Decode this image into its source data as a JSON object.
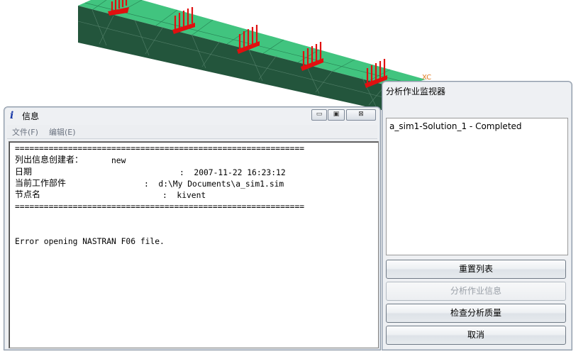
{
  "viewport": {
    "axis_label": "XC"
  },
  "info_window": {
    "title": "信息",
    "controls": {
      "minimize": "▭",
      "maximize": "▣",
      "close": "⊠"
    },
    "menu": [
      "文件(F)",
      "编辑(E)"
    ],
    "separator": "============================================================",
    "lines": [
      {
        "label": "列出信息创建者：",
        "value": "new"
      },
      {
        "label": "日期",
        "value": ":  2007-11-22 16:23:12"
      },
      {
        "label": "当前工作部件",
        "value": ":  d:\\My Documents\\a_sim1.sim"
      },
      {
        "label": "节点名",
        "value": ":  kivent"
      }
    ],
    "error": "Error opening NASTRAN F06 file."
  },
  "monitor_window": {
    "title": "分析作业监视器",
    "list_items": [
      "a_sim1-Solution_1 - Completed"
    ],
    "buttons": [
      {
        "label": "重置列表",
        "enabled": true
      },
      {
        "label": "分析作业信息",
        "enabled": false
      },
      {
        "label": "检查分析质量",
        "enabled": true
      },
      {
        "label": "取消",
        "enabled": true
      }
    ]
  },
  "colors": {
    "beam_top": "#3dbd7a",
    "beam_side": "#24543c",
    "load_arrow": "#e01010",
    "window_bg": "#eef0f3"
  }
}
